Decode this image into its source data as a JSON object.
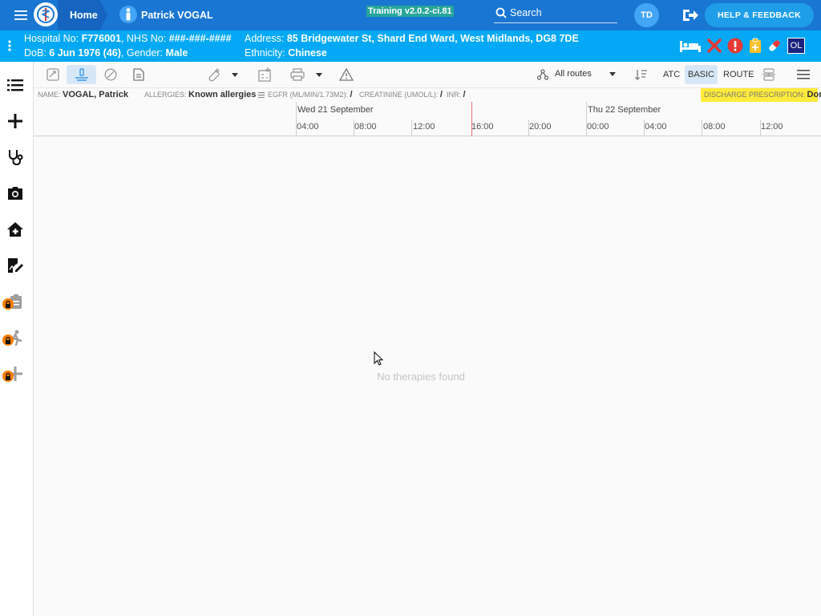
{
  "topbar": {
    "home_label": "Home",
    "patient_name": "Patrick VOGAL",
    "version": "Training v2.0.2-ci.81",
    "search_label": "Search",
    "user_initials": "TD",
    "help_label": "HELP & FEEDBACK"
  },
  "patient": {
    "hospital_no_label": "Hospital No:",
    "hospital_no": "F776001",
    "nhs_no_label": ", NHS No:",
    "nhs_no": "###-###-####",
    "address_label": "Address:",
    "address": "85 Bridgewater St, Shard End Ward, West Midlands, DG8 7DE",
    "dob_label": "DoB:",
    "dob": "6 Jun 1976 (46)",
    "gender_label": ", Gender:",
    "gender": "Male",
    "ethnicity_label": "Ethnicity:",
    "ethnicity": "Chinese",
    "ol_badge": "OL"
  },
  "toolbar": {
    "routes_label": "All routes",
    "atc_label": "ATC",
    "basic_label": "BASIC",
    "route_label": "ROUTE"
  },
  "infobar": {
    "name_label": "NAME:",
    "name": "VOGAL, Patrick",
    "allergies_label": "ALLERGIES:",
    "allergies": "Known allergies",
    "egfr_label": "EGFR (ML/MIN/1.73M2):",
    "egfr": "/",
    "creatinine_label": "CREATININE (UMOL/L):",
    "creatinine": "/",
    "inr_label": "INR:",
    "inr": "/",
    "discharge_label": "DISCHARGE PRESCRIPTION:",
    "discharge_value": "Done"
  },
  "timeline": {
    "day1": "Wed 21 September",
    "day2": "Thu 22 September",
    "times": [
      "04:00",
      "08:00",
      "12:00",
      "16:00",
      "20:00",
      "00:00",
      "04:00",
      "08:00",
      "12:00"
    ]
  },
  "content": {
    "empty_message": "No therapies found"
  },
  "colors": {
    "topbar": "#1976d2",
    "patient_bar": "#03a9f4",
    "help_button": "#1e9ee8",
    "alert_red": "#e53935",
    "discharge_yellow": "#ffeb3b"
  }
}
